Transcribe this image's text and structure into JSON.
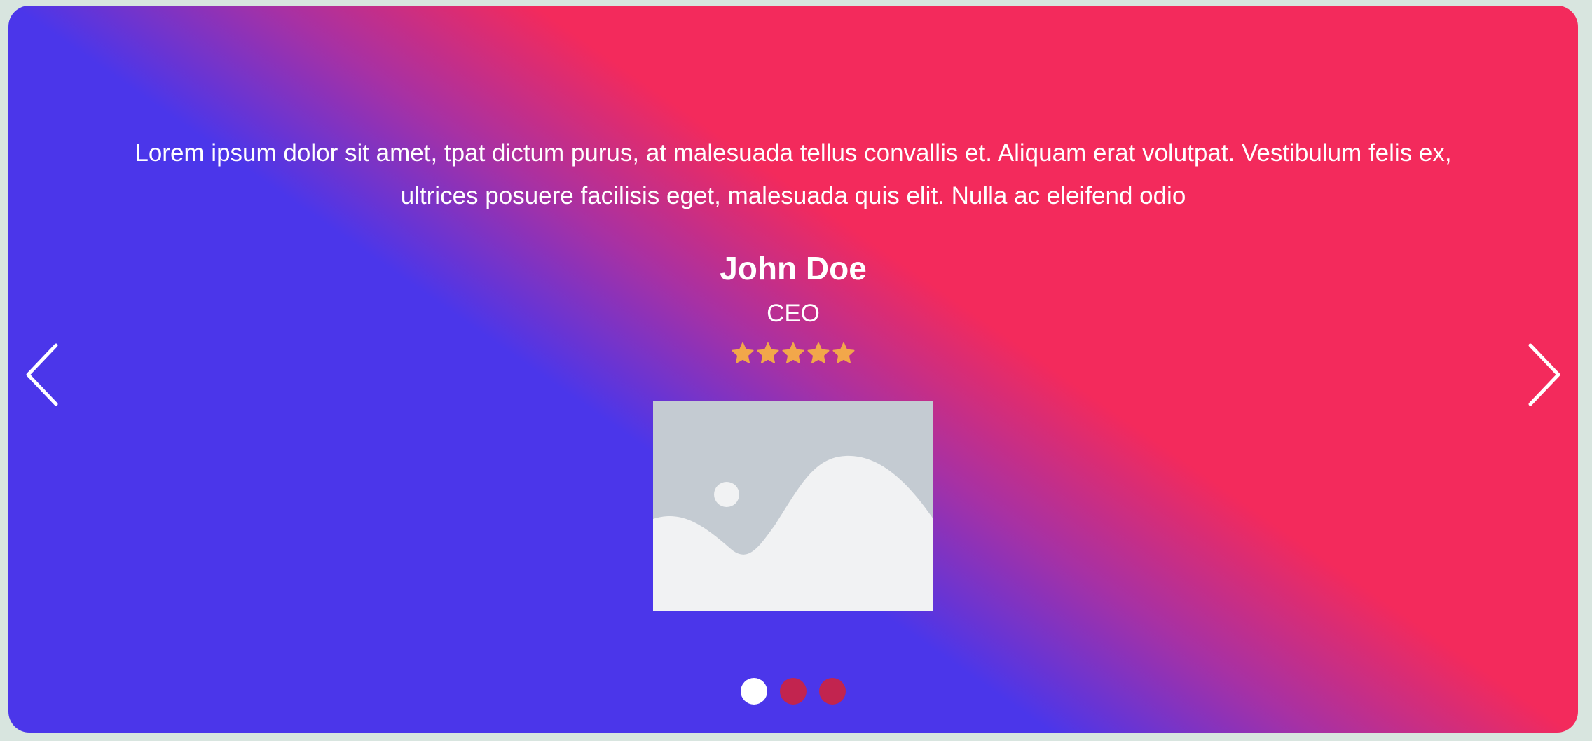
{
  "testimonial": {
    "quote": "Lorem ipsum dolor sit amet, tpat dictum purus, at malesuada tellus convallis et. Aliquam erat volutpat. Vestibulum felis ex, ultrices posuere facilisis eget, malesuada quis elit. Nulla ac eleifend odio",
    "name": "John Doe",
    "role": "CEO",
    "rating": 5,
    "rating_max": 5
  },
  "carousel": {
    "prev_icon": "chevron-left-icon",
    "next_icon": "chevron-right-icon",
    "slide_count": 3,
    "active_index": 0
  },
  "colors": {
    "gradient_start": "#4b36ea",
    "gradient_end": "#f32a5c",
    "star": "#f2a74a",
    "dot_active": "#ffffff",
    "dot_inactive": "#c2244f",
    "placeholder_bg": "#c4cbd2",
    "placeholder_fg": "#f1f2f3"
  }
}
